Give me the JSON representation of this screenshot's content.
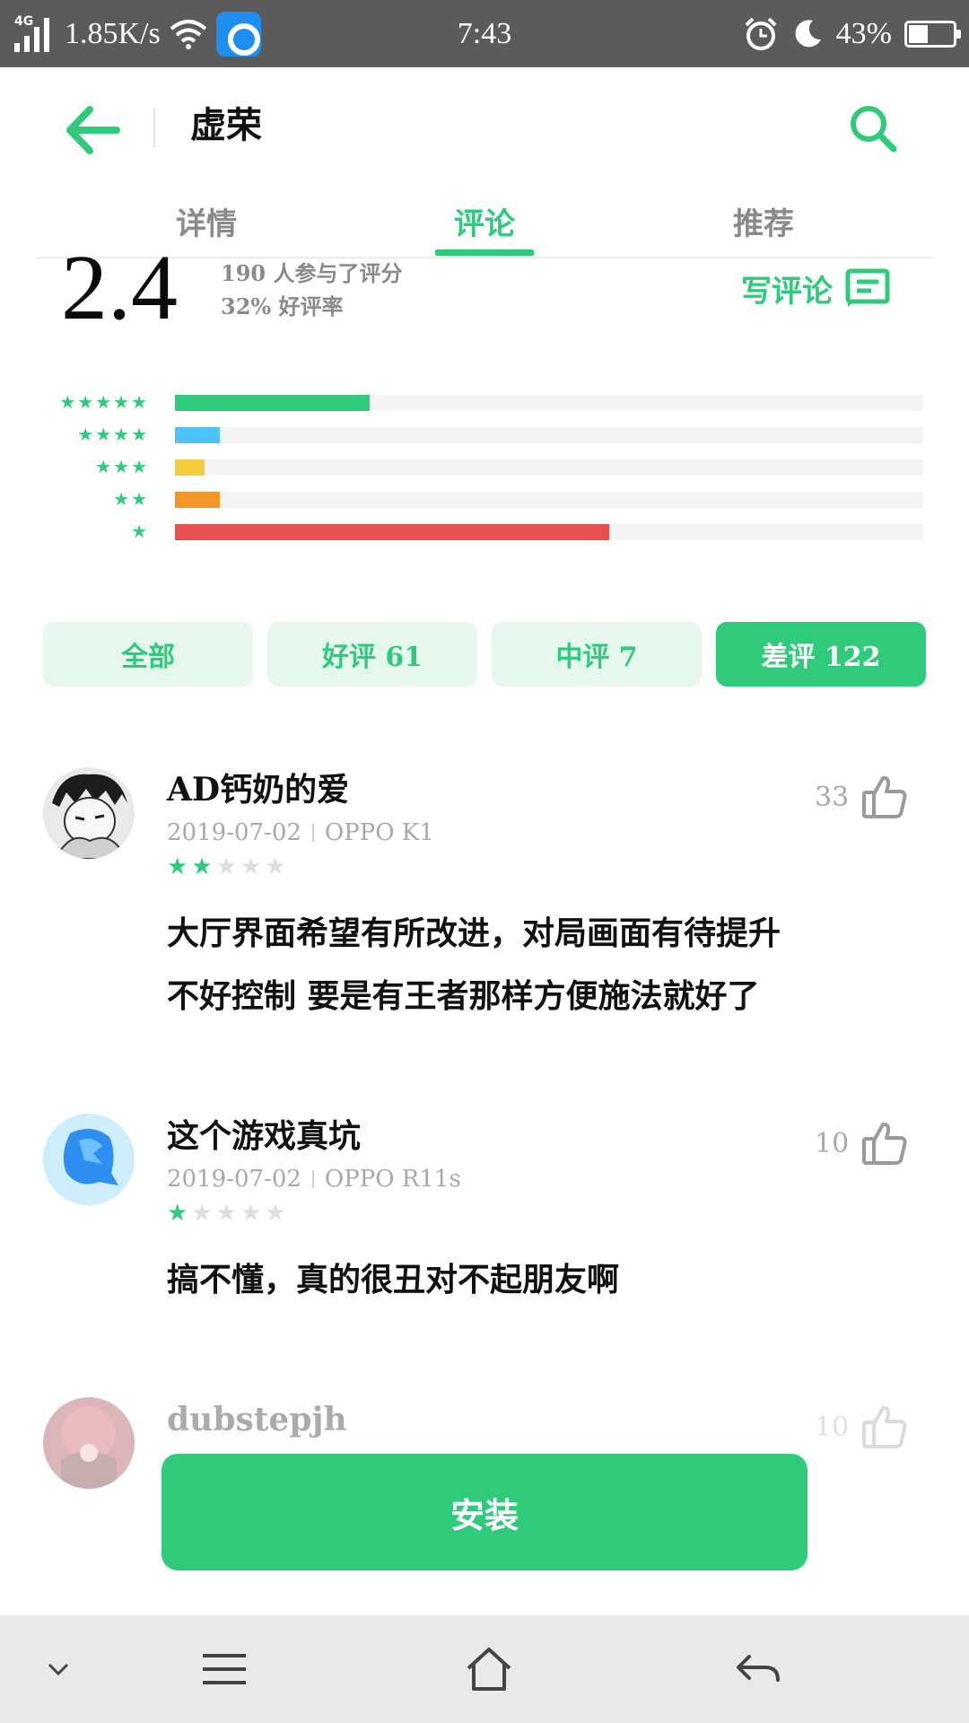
{
  "status_bar": {
    "network_type": "4G",
    "speed": "1.85K/s",
    "time": "7:43",
    "battery_percent": "43%",
    "battery_level": 0.43,
    "icons": [
      "signal-icon",
      "wifi-icon",
      "app-notification-icon",
      "alarm-icon",
      "moon-icon",
      "battery-icon"
    ]
  },
  "header": {
    "title": "虚荣",
    "back_icon": "arrow-left-icon",
    "search_icon": "search-icon"
  },
  "tabs": [
    {
      "label": "详情",
      "active": false
    },
    {
      "label": "评论",
      "active": true
    },
    {
      "label": "推荐",
      "active": false
    }
  ],
  "rating": {
    "score": "2.4",
    "participants": "190 人参与了评分",
    "positive_rate": "32% 好评率",
    "write_review_label": "写评论"
  },
  "distribution": [
    {
      "stars": 5,
      "fraction": 0.26,
      "color": "#2fcb7b"
    },
    {
      "stars": 4,
      "fraction": 0.06,
      "color": "#4fc3f7"
    },
    {
      "stars": 3,
      "fraction": 0.04,
      "color": "#f4cb3a"
    },
    {
      "stars": 2,
      "fraction": 0.06,
      "color": "#f2962a"
    },
    {
      "stars": 1,
      "fraction": 0.58,
      "color": "#e85150"
    }
  ],
  "filters": [
    {
      "label": "全部",
      "active": false
    },
    {
      "label": "好评 61",
      "active": false
    },
    {
      "label": "中评 7",
      "active": false
    },
    {
      "label": "差评 122",
      "active": true
    }
  ],
  "reviews": [
    {
      "name": "AD钙奶的爱",
      "date": "2019-07-02",
      "device": "OPPO K1",
      "stars": 2,
      "likes": "33",
      "text_lines": [
        "大厅界面希望有所改进，对局画面有待提升",
        "不好控制 要是有王者那样方便施法就好了"
      ]
    },
    {
      "name": "这个游戏真坑",
      "date": "2019-07-02",
      "device": "OPPO R11s",
      "stars": 1,
      "likes": "10",
      "text_lines": [
        "搞不懂，真的很丑对不起朋友啊"
      ]
    },
    {
      "name": "dubstepjh",
      "likes": "10"
    }
  ],
  "install_label": "安装",
  "colors": {
    "accent": "#2fcb7b",
    "chip_bg": "#e6f8ee",
    "statusbar_bg": "#5b5b5b",
    "navbar_bg": "#e9e9e9"
  },
  "nav_icons": [
    "chevron-down-icon",
    "menu-icon",
    "home-icon",
    "back-icon"
  ]
}
